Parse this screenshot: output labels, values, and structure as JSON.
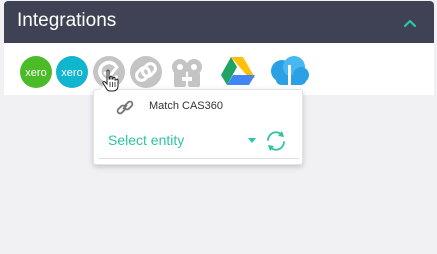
{
  "panel": {
    "title": "Integrations",
    "collapse_icon": "chevron-up-icon"
  },
  "integrations": [
    {
      "name": "Xero",
      "icon_text": "xero",
      "color": "#4cbb28",
      "state": "active"
    },
    {
      "name": "Xero",
      "icon_text": "xero",
      "color": "#12b5ce",
      "state": "active"
    },
    {
      "name": "CAS360",
      "icon_text": "",
      "color": "#c4c4c4",
      "state": "inactive"
    },
    {
      "name": "Link",
      "icon_text": "",
      "color": "#c4c4c4",
      "state": "inactive"
    },
    {
      "name": "Practice",
      "icon_text": "",
      "color": "#c4c4c4",
      "state": "inactive"
    },
    {
      "name": "Google Drive",
      "icon_text": "",
      "color": "#1fa463",
      "state": "active"
    },
    {
      "name": "Cloud",
      "icon_text": "",
      "color": "#2aa1e4",
      "state": "active"
    }
  ],
  "popover": {
    "match_label": "Match CAS360",
    "entity_select": {
      "value": "Select entity"
    },
    "sync_icon": "sync-icon",
    "link_icon": "link-icon"
  },
  "colors": {
    "header_bg": "#3e4254",
    "accent": "#2ec4a2",
    "page_bg": "#f1f1f4"
  }
}
